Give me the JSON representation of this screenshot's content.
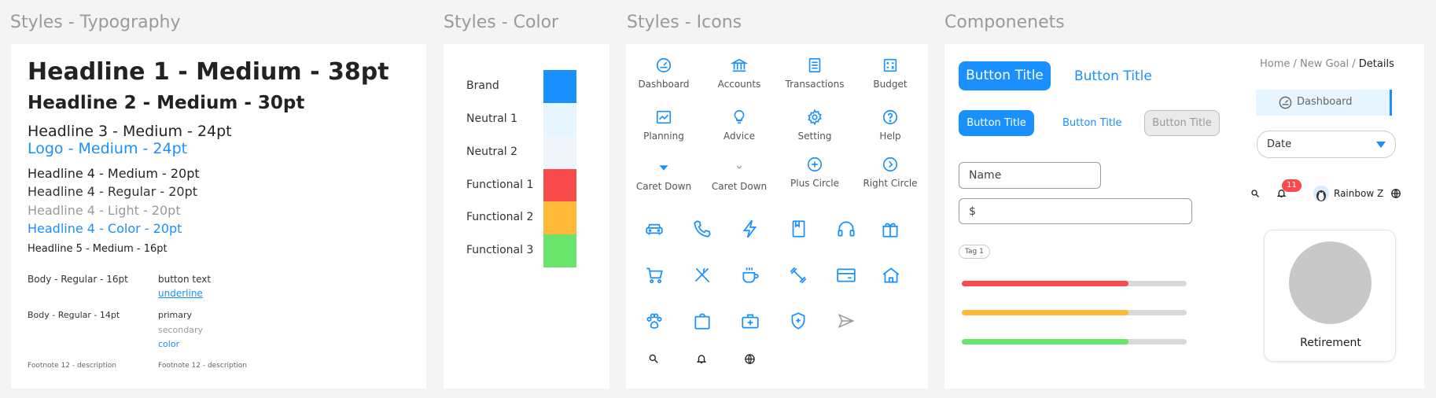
{
  "sections": {
    "typography": "Styles - Typography",
    "color": "Styles - Color",
    "icons": "Styles - Icons",
    "components": "Componenets"
  },
  "typography": {
    "h1": "Headline 1 - Medium - 38pt",
    "h2": "Headline 2 - Medium - 30pt",
    "h3": "Headline 3 - Medium - 24pt",
    "logo": "Logo - Medium - 24pt",
    "h4_medium": "Headline 4 - Medium - 20pt",
    "h4_regular": "Headline 4 - Regular - 20pt",
    "h4_light": "Headline 4 - Light - 20pt",
    "h4_color": "Headline 4 - Color - 20pt",
    "h5": "Headline 5 - Medium - 16pt",
    "body16": "Body - Regular - 16pt",
    "button_text": "button text",
    "underline": "underline",
    "body14": "Body - Regular - 14pt",
    "primary": "primary",
    "secondary": "secondary",
    "color": "color",
    "footnote_left": "Footnote 12 - description",
    "footnote_right": "Footnote 12 - description"
  },
  "colors": [
    {
      "label": "Brand",
      "hex": "#1a90ff"
    },
    {
      "label": "Neutral 1",
      "hex": "#e6f5ff"
    },
    {
      "label": "Neutral 2",
      "hex": "#f0f5fc"
    },
    {
      "label": "Functional 1",
      "hex": "#f94b4b"
    },
    {
      "label": "Functional 2",
      "hex": "#ffb938"
    },
    {
      "label": "Functional 3",
      "hex": "#6ae46c"
    }
  ],
  "icons": {
    "labeled": [
      "Dashboard",
      "Accounts",
      "Transactions",
      "Budget",
      "Planning",
      "Advice",
      "Setting",
      "Help",
      "Caret Down",
      "Caret Down",
      "Plus Circle",
      "Right Circle"
    ],
    "accent": "#1a90ff"
  },
  "components": {
    "button_large": "Button Title",
    "button_large_text": "Button Title",
    "button_small": "Button Title",
    "button_small_text": "Button Title",
    "button_disabled": "Button Title",
    "name_placeholder": "Name",
    "dollar_placeholder": "$",
    "tag": "Tag 1",
    "progress": [
      {
        "value": 0.74,
        "color": "#f94b4b"
      },
      {
        "value": 0.74,
        "color": "#ffb938"
      },
      {
        "value": 0.74,
        "color": "#6ae46c"
      }
    ],
    "breadcrumb": {
      "home": "Home",
      "sep1": " / ",
      "goal": "New Goal",
      "sep2": " / ",
      "current": "Details"
    },
    "nav_item": "Dashboard",
    "dropdown": "Date",
    "badge_count": "11",
    "user_name": "Rainbow Z",
    "card_label": "Retirement"
  }
}
